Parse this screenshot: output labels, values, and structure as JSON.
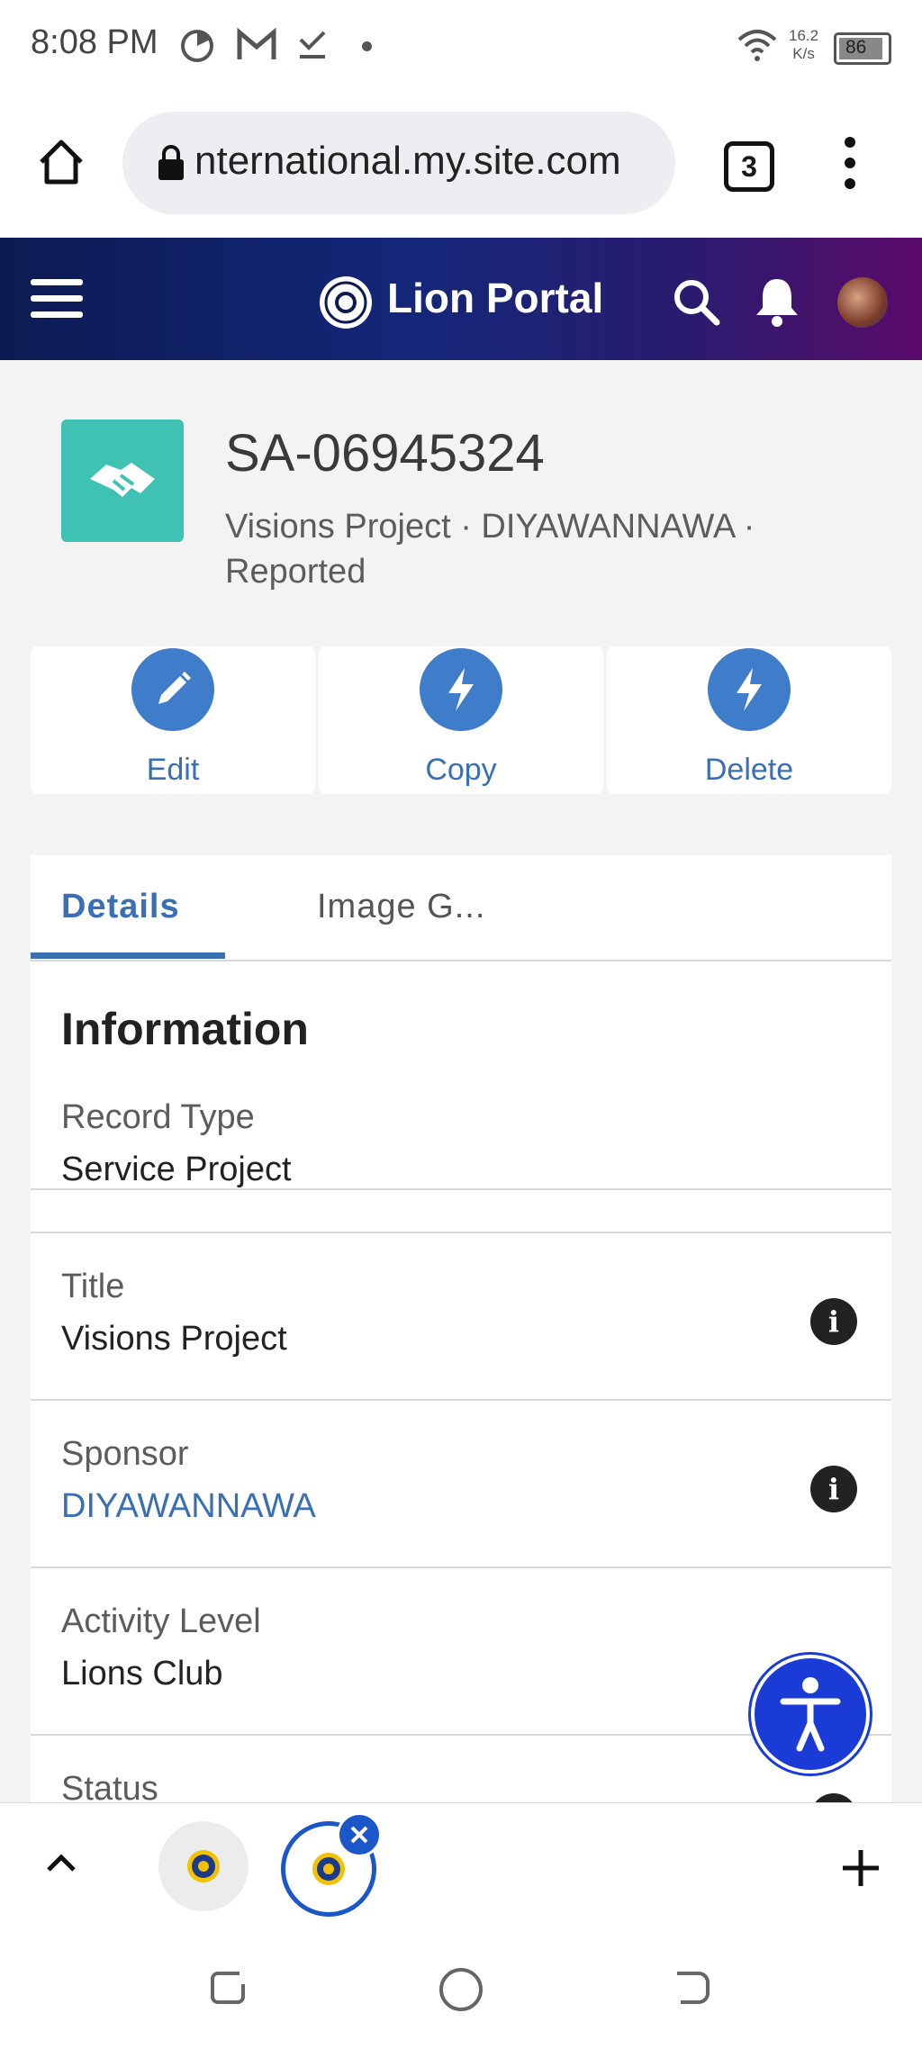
{
  "status_bar": {
    "time": "8:08 PM",
    "net_speed_value": "16.2",
    "net_speed_unit": "K/s",
    "battery": "86"
  },
  "browser": {
    "url": "nternational.my.site.com",
    "tab_count": "3"
  },
  "portal": {
    "title": "Lion Portal"
  },
  "record": {
    "id": "SA-06945324",
    "meta_line1": "Visions Project  ·  DIYAWANNAWA  ·",
    "meta_line2": "Reported"
  },
  "actions": [
    {
      "label": "Edit",
      "icon": "pencil-icon"
    },
    {
      "label": "Copy",
      "icon": "lightning-icon"
    },
    {
      "label": "Delete",
      "icon": "lightning-icon"
    }
  ],
  "tabs": [
    {
      "label": "Details",
      "active": true
    },
    {
      "label": "Image G..."
    }
  ],
  "section_heading": "Information",
  "fields": [
    {
      "label": "Record Type",
      "value": "Service Project"
    },
    {
      "label": "Title",
      "value": "Visions Project"
    },
    {
      "label": "Sponsor",
      "value": "DIYAWANNAWA"
    },
    {
      "label": "Activity Level",
      "value": "Lions Club"
    },
    {
      "label": "Status",
      "value": ""
    }
  ],
  "colors": {
    "accent": "#3a6fb4",
    "action_circle": "#3f7cc9",
    "record_icon": "#3fc1b3",
    "a11y_button": "#1a3bd6"
  }
}
